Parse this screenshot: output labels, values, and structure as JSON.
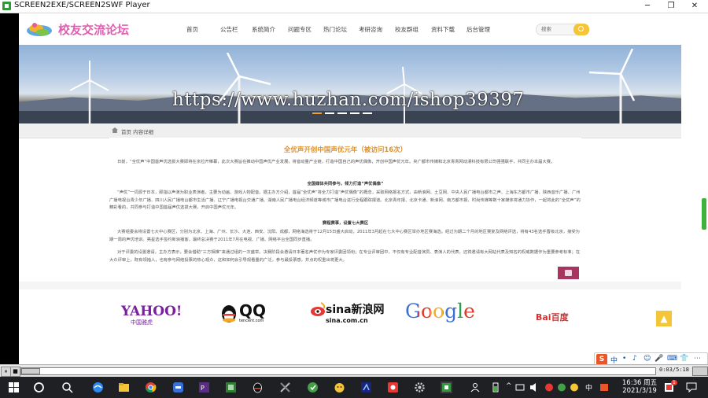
{
  "window": {
    "title": "SCREEN2EXE/SCREEN2SWF Player",
    "minimize": "─",
    "restore": "❐",
    "close": "✕"
  },
  "site": {
    "logo_text": "校友交流论坛",
    "nav": [
      "首页",
      "公告栏",
      "系统简介",
      "问题专区",
      "热门论坛",
      "考研咨询",
      "校友群组",
      "资料下载",
      "后台管理"
    ],
    "search_placeholder": "搜索",
    "watermark": "https://www.huzhan.com/ishop39397",
    "breadcrumb": "首页 内容详细"
  },
  "article": {
    "title": "全优声开创中国声优元年（被访问16次）",
    "p1": "日前，“全优声”中国首声优选拔大赛即将在京拉开帷幕，此次大赛旨在推动中国声优产业发展，将音动量产业链，打造中国自己的声优偶像，开创中国声优元年。央广都市传媒和北京青青网动漫科技有限公司强强联手，共同主办本届大赛。",
    "s1": "全国媒体共同参与，倾力打造“声优偶像”",
    "p2": "“声优”一词源于日本，即指以声演为职业表演者，主要为动画、游戏人物配音。据主办方介绍，首届“全优声”将全力打造“声优偶像”的概念，采取网络报名方式，由新浪网、土豆网、中央人民广播电台都市之声、上海东方都市广播、陕西音乐广播、广州广播电视台青少年广播、四川人民广播电台都市生活广播、辽宁广播电视台交通广播、湖南人民广播电台经济频道等城市广播电台进行全程跟踪报道。北京青年报、北京卡通、新浪网、南方都市报、时尚传媒等数十家媒体将通力协作，一起将此的“全优声”的精彩看的，共同参与打造中国首届声优选拔大赛，开启中国声优元年。",
    "s2": "赛程赛事，设置七大赛区",
    "p3": "大赛组委会将设置七大中心赛区，分别为北京、上海、广州、长沙、大连、西安、沈阳、成都，网络海选将于12月15日盛大启动，2011年3月起在七大中心赛区举办地区赛海选。经过为期二个月的地区赛复及网络评选，将有43名选手晋级北京，接受为期一周的声优培训。亮星选手签约新浪播客，最终总决赛于2011年7月在电视、广播、网络平台全国同步直播。",
    "p4": "对于评委的设置邀请，主办方表示，要会借助“三方相推”来通过组的一次盛举。决赛阶段会邀请日本著名声优作为专家评委团领衔；在专业评审团中，不仅有专业配音演员、表演人的代表，还将邀请有大网站代表及知名的权威数据作为重要参考标准；在大众评审上，既有领袖人，也有参与网络投票的热心观众，这和如何会引导观看量的广泛，参与最投票感，并点的权重出将更大。"
  },
  "partners": [
    {
      "name": "YAHOO!",
      "sub": "中国雅虎"
    },
    {
      "name": "QQ",
      "sub": "tencent.com"
    },
    {
      "name": "sina新浪网",
      "sub": "sina.com.cn"
    },
    {
      "name": "Google",
      "sub": ""
    },
    {
      "name": "Bai百度",
      "sub": ""
    }
  ],
  "player": {
    "pause": "⏸",
    "stop": "■",
    "time": "0:03/5:18"
  },
  "ime": {
    "logo": "S",
    "items": [
      "中",
      "•",
      "♪",
      "☺",
      "🎤",
      "⌨",
      "👕",
      "⋯"
    ]
  },
  "taskbar": {
    "time": "16:36 周五",
    "date": "2021/3/19",
    "lang": "中",
    "badge": "1"
  },
  "colors": {
    "accent": "#f4c537",
    "logo_pink": "#e05fb0",
    "title_orange": "#e0922a"
  }
}
